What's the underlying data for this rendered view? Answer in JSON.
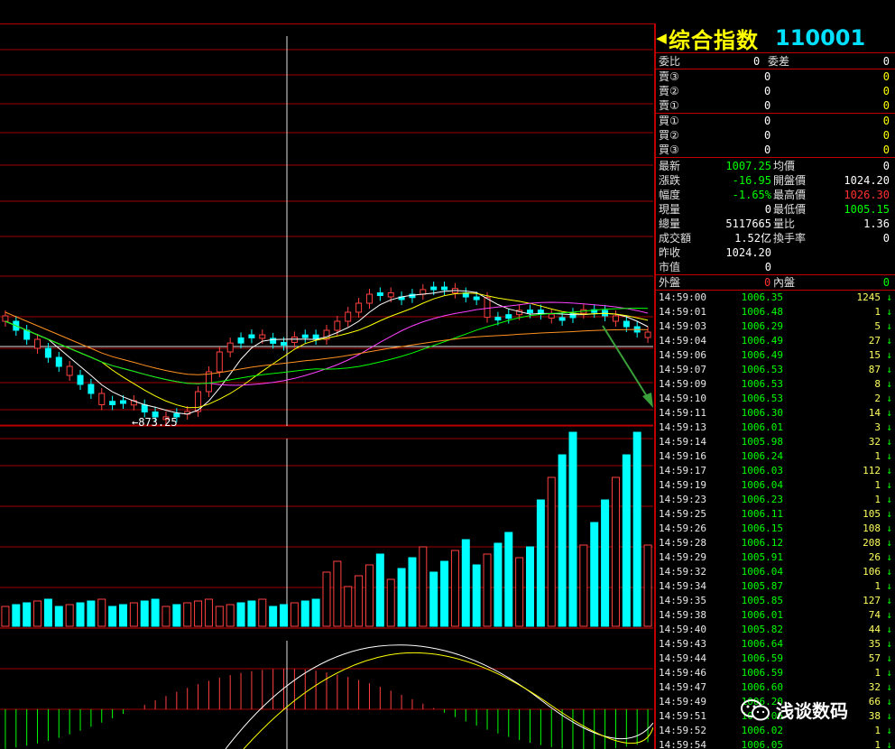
{
  "header": {
    "name": "综合指数",
    "code": "110001",
    "left_arrow": "◀",
    "right_arrow": "▶"
  },
  "order_book": {
    "weibi_label": "委比",
    "weibi_value": "0",
    "weicha_label": "委差",
    "weicha_value": "0",
    "asks": [
      {
        "label": "賣③",
        "price": "0",
        "vol": "0"
      },
      {
        "label": "賣②",
        "price": "0",
        "vol": "0"
      },
      {
        "label": "賣①",
        "price": "0",
        "vol": "0"
      }
    ],
    "bids": [
      {
        "label": "買①",
        "price": "0",
        "vol": "0"
      },
      {
        "label": "買②",
        "price": "0",
        "vol": "0"
      },
      {
        "label": "買③",
        "price": "0",
        "vol": "0"
      }
    ]
  },
  "quote": {
    "rows": [
      {
        "l1": "最新",
        "v1": "1007.25",
        "c1": "#00ff00",
        "l2": "均價",
        "v2": "0",
        "c2": "#ffffff"
      },
      {
        "l1": "漲跌",
        "v1": "-16.95",
        "c1": "#00ff00",
        "l2": "開盤價",
        "v2": "1024.20",
        "c2": "#ffffff"
      },
      {
        "l1": "幅度",
        "v1": "-1.65%",
        "c1": "#00ff00",
        "l2": "最高價",
        "v2": "1026.30",
        "c2": "#ff3030"
      },
      {
        "l1": "現量",
        "v1": "0",
        "c1": "#ffffff",
        "l2": "最低價",
        "v2": "1005.15",
        "c2": "#00ff00"
      },
      {
        "l1": "總量",
        "v1": "5117665",
        "c1": "#ffffff",
        "l2": "量比",
        "v2": "1.36",
        "c2": "#ffffff"
      },
      {
        "l1": "成交額",
        "v1": "1.52亿",
        "c1": "#ffffff",
        "l2": "換手率",
        "v2": "0",
        "c2": "#ffffff"
      },
      {
        "l1": "昨收",
        "v1": "1024.20",
        "c1": "#ffffff",
        "l2": "",
        "v2": "",
        "c2": "#ffffff"
      },
      {
        "l1": "市值",
        "v1": "0",
        "c1": "#ffffff",
        "l2": "",
        "v2": "",
        "c2": "#ffffff"
      }
    ],
    "waipan_label": "外盤",
    "waipan_value": "0",
    "neipan_label": "內盤",
    "neipan_value": "0"
  },
  "ticks": [
    {
      "time": "14:59:00",
      "price": "1006.35",
      "vol": "1245"
    },
    {
      "time": "14:59:01",
      "price": "1006.48",
      "vol": "1"
    },
    {
      "time": "14:59:03",
      "price": "1006.29",
      "vol": "5"
    },
    {
      "time": "14:59:04",
      "price": "1006.49",
      "vol": "27"
    },
    {
      "time": "14:59:06",
      "price": "1006.49",
      "vol": "15"
    },
    {
      "time": "14:59:07",
      "price": "1006.53",
      "vol": "87"
    },
    {
      "time": "14:59:09",
      "price": "1006.53",
      "vol": "8"
    },
    {
      "time": "14:59:10",
      "price": "1006.53",
      "vol": "2"
    },
    {
      "time": "14:59:11",
      "price": "1006.30",
      "vol": "14"
    },
    {
      "time": "14:59:13",
      "price": "1006.01",
      "vol": "3"
    },
    {
      "time": "14:59:14",
      "price": "1005.98",
      "vol": "32"
    },
    {
      "time": "14:59:16",
      "price": "1006.24",
      "vol": "1"
    },
    {
      "time": "14:59:17",
      "price": "1006.03",
      "vol": "112"
    },
    {
      "time": "14:59:19",
      "price": "1006.04",
      "vol": "1"
    },
    {
      "time": "14:59:23",
      "price": "1006.23",
      "vol": "1"
    },
    {
      "time": "14:59:25",
      "price": "1006.11",
      "vol": "105"
    },
    {
      "time": "14:59:26",
      "price": "1006.15",
      "vol": "108"
    },
    {
      "time": "14:59:28",
      "price": "1006.12",
      "vol": "208"
    },
    {
      "time": "14:59:29",
      "price": "1005.91",
      "vol": "26"
    },
    {
      "time": "14:59:32",
      "price": "1006.04",
      "vol": "106"
    },
    {
      "time": "14:59:34",
      "price": "1005.87",
      "vol": "1"
    },
    {
      "time": "14:59:35",
      "price": "1005.85",
      "vol": "127"
    },
    {
      "time": "14:59:38",
      "price": "1006.01",
      "vol": "74"
    },
    {
      "time": "14:59:40",
      "price": "1005.82",
      "vol": "44"
    },
    {
      "time": "14:59:43",
      "price": "1006.64",
      "vol": "35"
    },
    {
      "time": "14:59:44",
      "price": "1006.59",
      "vol": "57"
    },
    {
      "time": "14:59:46",
      "price": "1006.59",
      "vol": "1"
    },
    {
      "time": "14:59:47",
      "price": "1006.60",
      "vol": "32"
    },
    {
      "time": "14:59:49",
      "price": "1006.20",
      "vol": "66"
    },
    {
      "time": "14:59:51",
      "price": "1006.06",
      "vol": "38"
    },
    {
      "time": "14:59:52",
      "price": "1006.02",
      "vol": "1"
    },
    {
      "time": "14:59:54",
      "price": "1006.05",
      "vol": "1"
    }
  ],
  "tick_direction_glyph": "↓",
  "chart": {
    "low_label": "873.25",
    "colors": {
      "up": "#ff4040",
      "down": "#00ffff",
      "grid": "#a00000",
      "ma5": "#ffffff",
      "ma10": "#ffff00",
      "ma20": "#ff40ff",
      "ma30": "#00ff00",
      "ma60": "#ff9020"
    }
  },
  "watermark": {
    "text": "浅谈数码"
  }
}
